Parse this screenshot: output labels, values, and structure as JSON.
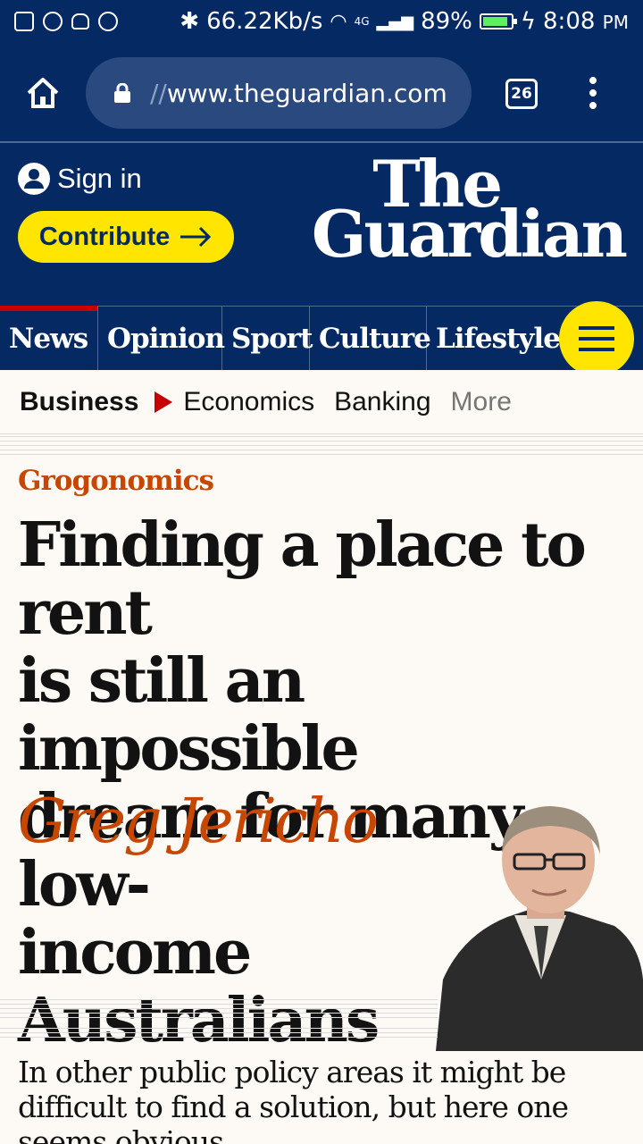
{
  "status_bar": {
    "speed": "66.22Kb/s",
    "network": "4G",
    "battery": "89%",
    "battery_level": 0.89,
    "time": "8:08",
    "meridiem": "PM"
  },
  "browser": {
    "url_prefix": "//",
    "url": "www.theguardian.com",
    "tab_count": "26"
  },
  "header": {
    "sign_in": "Sign in",
    "contribute": "Contribute",
    "logo_line1": "The",
    "logo_line2": "Guardian"
  },
  "pillars": [
    {
      "label": "News"
    },
    {
      "label": "Opinion"
    },
    {
      "label": "Sport"
    },
    {
      "label": "Culture"
    },
    {
      "label": "Lifestyle"
    }
  ],
  "subnav": {
    "section": "Business",
    "items": [
      "Economics",
      "Banking"
    ],
    "more": "More"
  },
  "article": {
    "kicker": "Grogonomics",
    "headline_lines": [
      "Finding a place to rent",
      "is still an impossible",
      "dream for many low-",
      "income Australians"
    ],
    "byline": "Greg Jericho",
    "standfirst_lines": [
      "In other public policy areas it might be",
      "difficult to find a solution, but here one",
      "seems obvious"
    ]
  },
  "colors": {
    "brand_blue": "#052962",
    "yellow": "#ffe500",
    "news_red": "#c70000",
    "opinion_orange": "#c74600",
    "background": "#fdf9f4"
  }
}
